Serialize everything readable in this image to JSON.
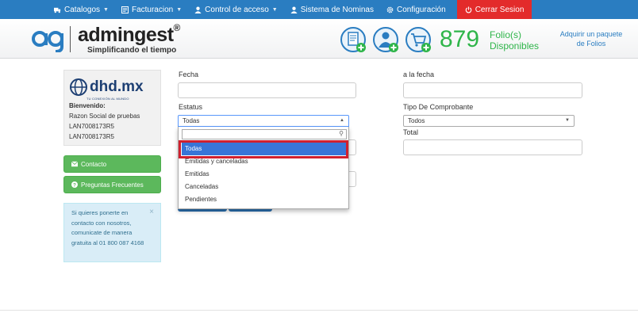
{
  "nav": {
    "catalogos": "Catalogos",
    "facturacion": "Facturacion",
    "control_acceso": "Control de acceso",
    "nominas": "Sistema de Nominas",
    "configuracion": "Configuración",
    "cerrar_sesion": "Cerrar Sesion"
  },
  "header": {
    "brand": "admingest",
    "registered": "®",
    "tagline": "Simplificando el tiempo",
    "folios_count": "879",
    "folios_label_1": "Folio(s)",
    "folios_label_2": "Disponibles",
    "adquirir": "Adquirir un paquete de Folios"
  },
  "profile": {
    "company_logo": "dhd.mx",
    "company_tagline": "TU CONEXIÓN AL MUNDO",
    "welcome": "Bienvenido:",
    "razon_social": "Razon Social de pruebas",
    "rfc_1": "LAN7008173R5",
    "rfc_2": "LAN7008173R5"
  },
  "sidebar": {
    "contacto": "Contacto",
    "preguntas": "Preguntas Frecuentes",
    "info_text": "Si quieres ponerte en contacto con nosotros, comunicate de manera gratuita al 01 800 087 4168",
    "info_close": "×"
  },
  "form": {
    "fecha_label": "Fecha",
    "a_la_fecha_label": "a la fecha",
    "estatus_label": "Estatus",
    "estatus_value": "Todas",
    "tipo_label": "Tipo De Comprobante",
    "tipo_value": "Todos",
    "total_label": "Total"
  },
  "dropdown": {
    "options": [
      "Todas",
      "Emitidas y canceladas",
      "Emitidas",
      "Canceladas",
      "Pendientes"
    ],
    "selected": "Todas"
  },
  "colors": {
    "nav_blue": "#2a7dc1",
    "logout_red": "#e32b2b",
    "folio_green": "#2fb54a",
    "highlight_red": "#d0202e",
    "select_blue": "#3875d7"
  }
}
